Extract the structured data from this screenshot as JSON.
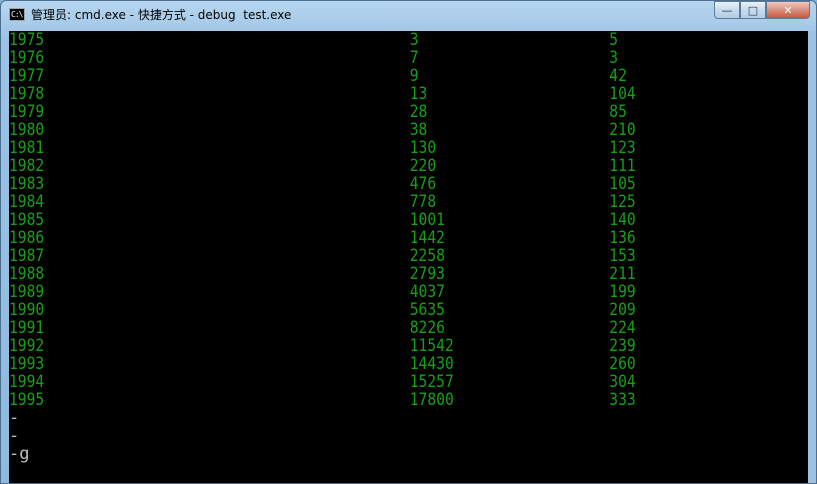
{
  "window": {
    "title": "管理员: cmd.exe - 快捷方式 - debug  test.exe",
    "icon_text": "C:\\",
    "controls": {
      "minimize": "—",
      "maximize": "□",
      "close": "✕"
    }
  },
  "console": {
    "rows": [
      [
        "1975",
        "3",
        "5"
      ],
      [
        "1976",
        "7",
        "3"
      ],
      [
        "1977",
        "9",
        "42"
      ],
      [
        "1978",
        "13",
        "104"
      ],
      [
        "1979",
        "28",
        "85"
      ],
      [
        "1980",
        "38",
        "210"
      ],
      [
        "1981",
        "130",
        "123"
      ],
      [
        "1982",
        "220",
        "111"
      ],
      [
        "1983",
        "476",
        "105"
      ],
      [
        "1984",
        "778",
        "125"
      ],
      [
        "1985",
        "1001",
        "140"
      ],
      [
        "1986",
        "1442",
        "136"
      ],
      [
        "1987",
        "2258",
        "153"
      ],
      [
        "1988",
        "2793",
        "211"
      ],
      [
        "1989",
        "4037",
        "199"
      ],
      [
        "1990",
        "5635",
        "209"
      ],
      [
        "1991",
        "8226",
        "224"
      ],
      [
        "1992",
        "11542",
        "239"
      ],
      [
        "1993",
        "14430",
        "260"
      ],
      [
        "1994",
        "15257",
        "304"
      ],
      [
        "1995",
        "17800",
        "333"
      ]
    ],
    "tail": [
      "-",
      "-",
      "-g"
    ]
  }
}
